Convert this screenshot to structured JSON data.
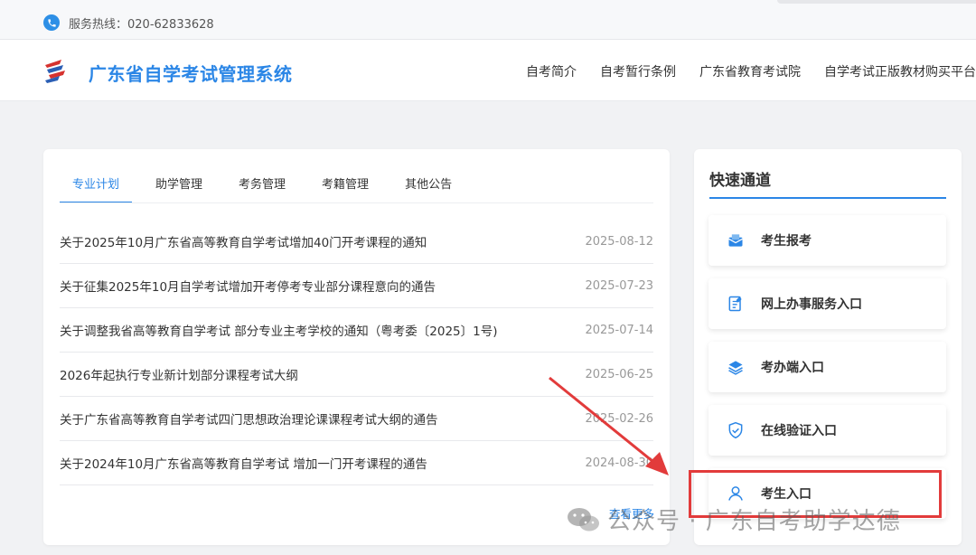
{
  "topbar": {
    "hotline": "服务热线：020-62833628"
  },
  "header": {
    "title": "广东省自学考试管理系统",
    "nav": [
      "自考简介",
      "自考暂行条例",
      "广东省教育考试院",
      "自学考试正版教材购买平台"
    ]
  },
  "tabs": [
    "专业计划",
    "助学管理",
    "考务管理",
    "考籍管理",
    "其他公告"
  ],
  "active_tab": "专业计划",
  "news": [
    {
      "title": "关于2025年10月广东省高等教育自学考试增加40门开考课程的通知",
      "date": "2025-08-12"
    },
    {
      "title": "关于征集2025年10月自学考试增加开考停考专业部分课程意向的通告",
      "date": "2025-07-23"
    },
    {
      "title": "关于调整我省高等教育自学考试 部分专业主考学校的通知（粤考委〔2025〕1号)",
      "date": "2025-07-14"
    },
    {
      "title": "2026年起执行专业新计划部分课程考试大纲",
      "date": "2025-06-25"
    },
    {
      "title": "关于广东省高等教育自学考试四门思想政治理论课课程考试大纲的通告",
      "date": "2025-02-26"
    },
    {
      "title": "关于2024年10月广东省高等教育自学考试 增加一门开考课程的通告",
      "date": "2024-08-30"
    }
  ],
  "more": "查看更多",
  "quick": {
    "title": "快速通道",
    "items": [
      {
        "label": "考生报考",
        "icon": "exam-registration-icon"
      },
      {
        "label": "网上办事服务入口",
        "icon": "online-service-icon"
      },
      {
        "label": "考办端入口",
        "icon": "layers-icon"
      },
      {
        "label": "在线验证入口",
        "icon": "shield-check-icon"
      },
      {
        "label": "考生入口",
        "icon": "user-icon"
      }
    ]
  },
  "watermark": "公众号 · 广东自考助学达德",
  "colors": {
    "accent": "#2b86e6",
    "highlight": "#e23b3b"
  }
}
